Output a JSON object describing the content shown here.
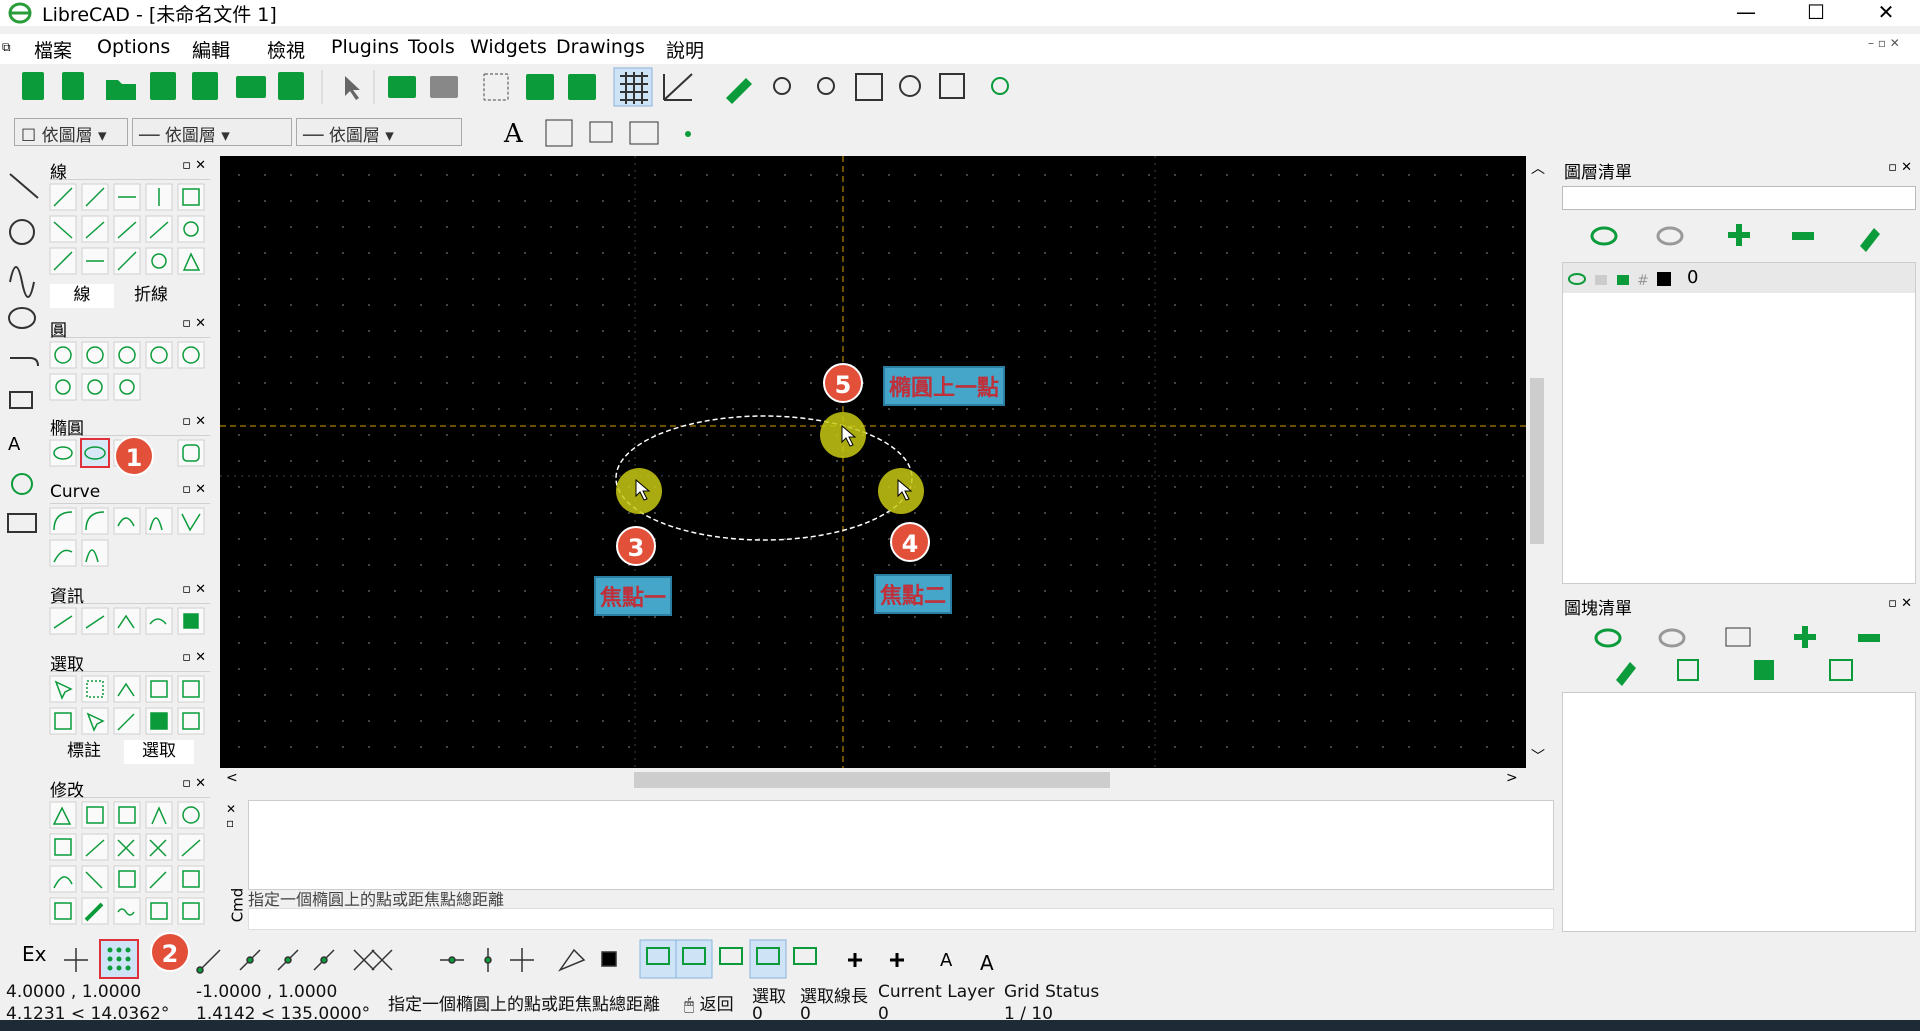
{
  "window": {
    "title": "LibreCAD - [未命名文件 1]",
    "minimize": "—",
    "maximize": "☐",
    "close": "✕"
  },
  "menu": [
    "檔案",
    "Options",
    "編輯",
    "檢視",
    "Plugins",
    "Tools",
    "Widgets",
    "Drawings",
    "說明"
  ],
  "pen_toolbar": {
    "color": "依圖層",
    "line_type": "依圖層",
    "line_width": "依圖層"
  },
  "palette": {
    "groups": [
      {
        "title": "線",
        "tabs": [
          "線",
          "折線"
        ]
      },
      {
        "title": "圓"
      },
      {
        "title": "橢圓"
      },
      {
        "title": "Curve"
      },
      {
        "title": "資訊"
      },
      {
        "title": "選取",
        "tabs": [
          "標註",
          "選取"
        ]
      },
      {
        "title": "修改"
      }
    ]
  },
  "annotations": {
    "c1": "1",
    "c2": "2",
    "c3": "3",
    "c4": "4",
    "c5": "5",
    "tag_focus1": "焦點一",
    "tag_focus2": "焦點二",
    "tag_point": "橢圓上一點"
  },
  "command": {
    "side_label": "Cmd",
    "prompt": "指定一個橢圓上的點或距焦點總距離"
  },
  "layers_panel": {
    "title": "圖層清單",
    "search_placeholder": "",
    "layer_name": "0"
  },
  "blocks_panel": {
    "title": "圖塊清單"
  },
  "statusbar": {
    "ex": "Ex",
    "abs_coord": "4.0000 , 1.0000",
    "abs_polar": "4.1231 < 14.0362°",
    "rel_coord": "-1.0000 , 1.0000",
    "rel_polar": "1.4142 < 135.0000°",
    "prompt": "指定一個橢圓上的點或距焦點總距離",
    "back": "返回",
    "sel_label": "選取",
    "sel_value": "0",
    "sel_len_label": "選取線長",
    "sel_len_value": "0",
    "layer_label": "Current Layer",
    "layer_value": "0",
    "grid_label": "Grid Status",
    "grid_value": "1 / 10"
  },
  "colors": {
    "canvas": "#000000",
    "accent_green": "#0b9b3a",
    "callout": "#e2503a",
    "tag_bg": "#46a6c9"
  }
}
